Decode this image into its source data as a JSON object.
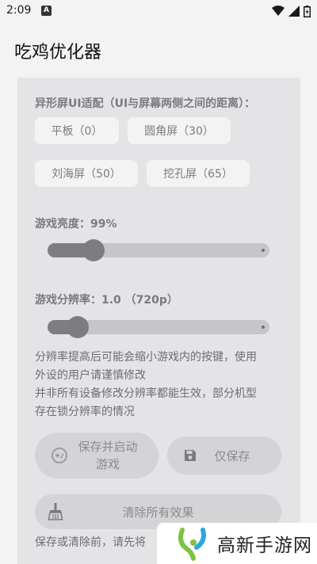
{
  "status_bar": {
    "time": "2:09",
    "a_badge": "A",
    "icons": [
      "wifi-icon",
      "signal-icon",
      "battery-icon"
    ]
  },
  "app_bar": {
    "title": "吃鸡优化器"
  },
  "notch": {
    "title": "异形屏UI适配（UI与屏幕两侧之间的距离）：",
    "options": [
      "平板（0）",
      "圆角屏（30）",
      "刘海屏（50）",
      "挖孔屏（65）"
    ]
  },
  "brightness": {
    "label": "游戏亮度：99%",
    "value": 99,
    "max": 100
  },
  "resolution": {
    "label": "游戏分辨率：1.0 （720p）",
    "fraction": 0.13
  },
  "notes": {
    "line1": "分辨率提高后可能会缩小游戏内的按键，使用",
    "line2": "外设的用户请谨慎修改",
    "line3": "并非所有设备修改分辨率都能生效，部分机型",
    "line4": "存在锁分辨率的情况"
  },
  "buttons": {
    "save_start_line1": "保存并启动",
    "save_start_line2": "游戏",
    "save_only": "仅保存",
    "clear_all": "清除所有效果"
  },
  "footer_note": "保存或清除前，请先将",
  "watermark": {
    "text": "高新手游网"
  },
  "colors": {
    "panel": "#e4e4e6",
    "chip": "#f3f3f4",
    "slider_active": "#7e7e80",
    "watermark_green": "#7dc242"
  }
}
